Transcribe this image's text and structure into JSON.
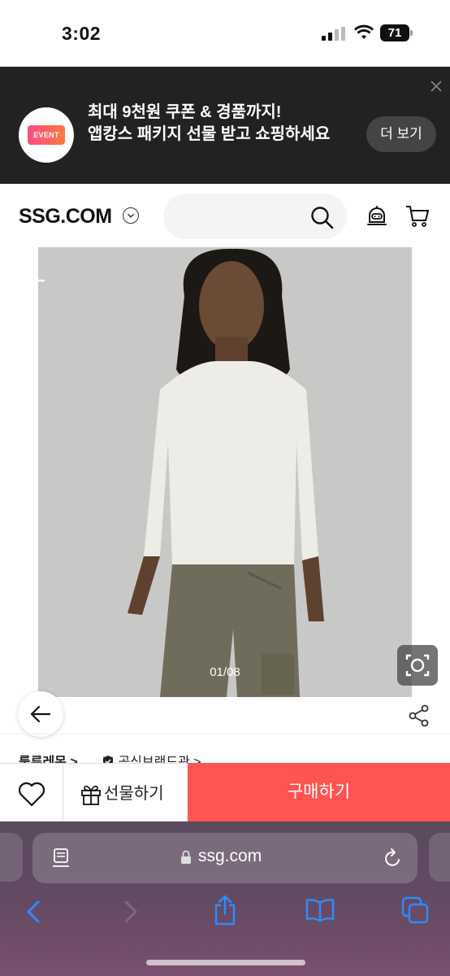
{
  "status_bar": {
    "time": "3:02",
    "battery": "71"
  },
  "app_banner": {
    "event_badge": "EVENT",
    "line1": "최대 9천원 쿠폰 & 경품까지!",
    "line2": "앱캉스 패키지 선물 받고 쇼핑하세요",
    "more_button": "더 보기"
  },
  "header": {
    "logo": "SSG.COM",
    "search_placeholder": ""
  },
  "product": {
    "page_indicator": "01/08",
    "brand": "룰루레몬 >",
    "official_store": "공식브랜드관 >"
  },
  "action_bar": {
    "gift_label": "선물하기",
    "buy_label": "구매하기"
  },
  "browser": {
    "url": "ssg.com"
  },
  "colors": {
    "buy_button": "#ff5452",
    "banner_bg": "#222222",
    "browser_tint": "#6b4b66"
  },
  "icons": [
    "signal-icon",
    "wifi-icon",
    "battery-icon",
    "close-icon",
    "chevron-down-icon",
    "search-icon",
    "chatbot-icon",
    "cart-icon",
    "arrow-left-icon",
    "camera-search-icon",
    "share-icon",
    "heart-icon",
    "gift-icon",
    "reader-icon",
    "lock-icon",
    "reload-icon",
    "chevron-left-icon",
    "chevron-right-icon",
    "share-up-icon",
    "book-icon",
    "tabs-icon"
  ]
}
